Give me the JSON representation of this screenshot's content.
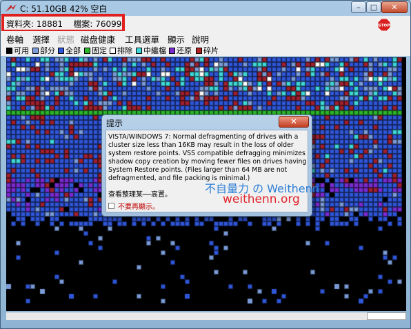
{
  "window": {
    "title": "C:  51.10GB 42% 空白",
    "minimize": "–",
    "maximize": "□",
    "close": "✕"
  },
  "info": {
    "folders_label": "資料夾:",
    "folders": "18881",
    "files_label": "檔案:",
    "files": "76099"
  },
  "stop_icon": "stop-icon",
  "menu": [
    "卷軸",
    "選擇",
    "狀態",
    "磁盘健康",
    "工具選單",
    "顯示",
    "說明"
  ],
  "legend": [
    {
      "label": "可用",
      "color": "#000000"
    },
    {
      "label": "部分",
      "color": "#7a9bd8"
    },
    {
      "label": "全部",
      "color": "#2f56d8"
    },
    {
      "label": "固定",
      "color": "#2bb52b"
    },
    {
      "label": "排除",
      "color": "#ffffff"
    },
    {
      "label": "中繼檔",
      "color": "#3fd8d8"
    },
    {
      "label": "还原",
      "color": "#7a2bd0"
    },
    {
      "label": "碎片",
      "color": "#b02020"
    }
  ],
  "dialog": {
    "title": "提示",
    "close": "✕",
    "message": "VISTA/WINDOWS 7: Normal defragmenting of drives with a cluster size less than 16KB may result in the loss of older system restore points. VSS compatible defragging minimizes shadow copy creation by moving fewer files on drives having System Restore points. (Files larger than 64 MB are not defragmented, and file packing is minimal.)",
    "tip": "查看整理某──高置。",
    "checkbox_label": "不要再顯示。"
  },
  "watermark": {
    "line1": "不自量力 の Weithenn",
    "line2": "weithenn.org"
  }
}
